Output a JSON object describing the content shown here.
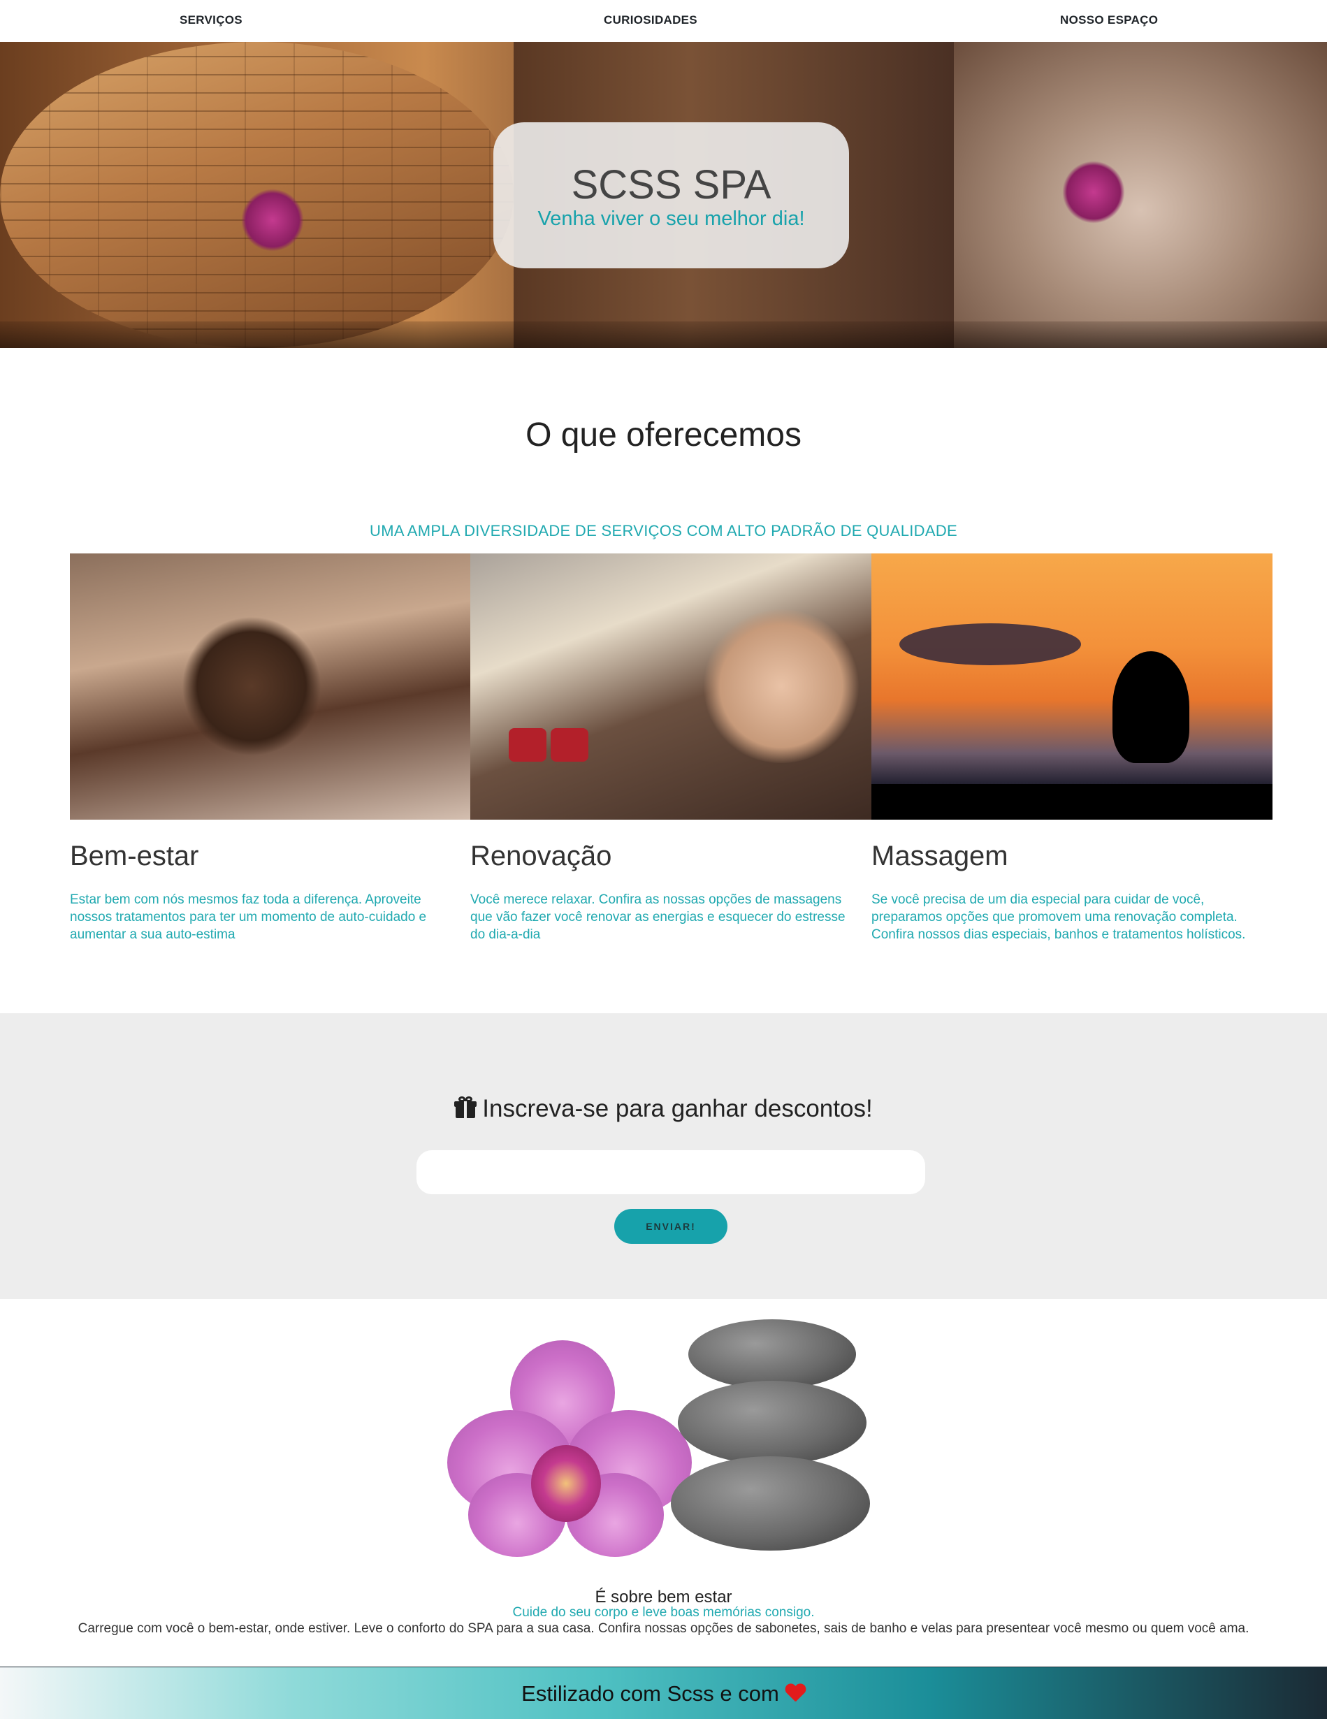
{
  "nav": {
    "items": [
      {
        "label": "SERVIÇOS"
      },
      {
        "label": "CURIOSIDADES"
      },
      {
        "label": "NOSSO ESPAÇO"
      }
    ]
  },
  "hero": {
    "title": "SCSS SPA",
    "subtitle": "Venha viver o seu melhor dia!"
  },
  "offer": {
    "title": "O que oferecemos",
    "subtitle": "UMA AMPLA DIVERSIDADE DE SERVIÇOS COM ALTO PADRÃO DE QUALIDADE",
    "cards": [
      {
        "title": "Bem-estar",
        "text": "Estar bem com nós mesmos faz toda a diferença. Aproveite nossos tratamentos para ter um momento de auto-cuidado e aumentar a sua auto-estima"
      },
      {
        "title": "Renovação",
        "text": "Você merece relaxar. Confira as nossas opções de massagens que vão fazer você renovar as energias e esquecer do estresse do dia-a-dia"
      },
      {
        "title": "Massagem",
        "text": "Se você precisa de um dia especial para cuidar de você, preparamos opções que promovem uma renovação completa. Confira nossos dias especiais, banhos e tratamentos holísticos."
      }
    ]
  },
  "subscribe": {
    "title": "Inscreva-se para ganhar descontos!",
    "email_value": "",
    "button_label": "ENVIAR!"
  },
  "about": {
    "heading": "É sobre bem estar",
    "subheading": "Cuide do seu corpo e leve boas memórias consigo.",
    "text": "Carregue com você o bem-estar, onde estiver. Leve o conforto do SPA para a sua casa. Confira nossas opções de sabonetes, sais de banho e velas para presentear você mesmo ou quem você ama."
  },
  "footer": {
    "text": "Estilizado com Scss e com"
  },
  "colors": {
    "accent": "#17a2ab",
    "subscribe_bg": "#ededed",
    "heart": "#e21c1c"
  },
  "icons": {
    "gift": "gift-icon",
    "heart": "heart-icon"
  }
}
